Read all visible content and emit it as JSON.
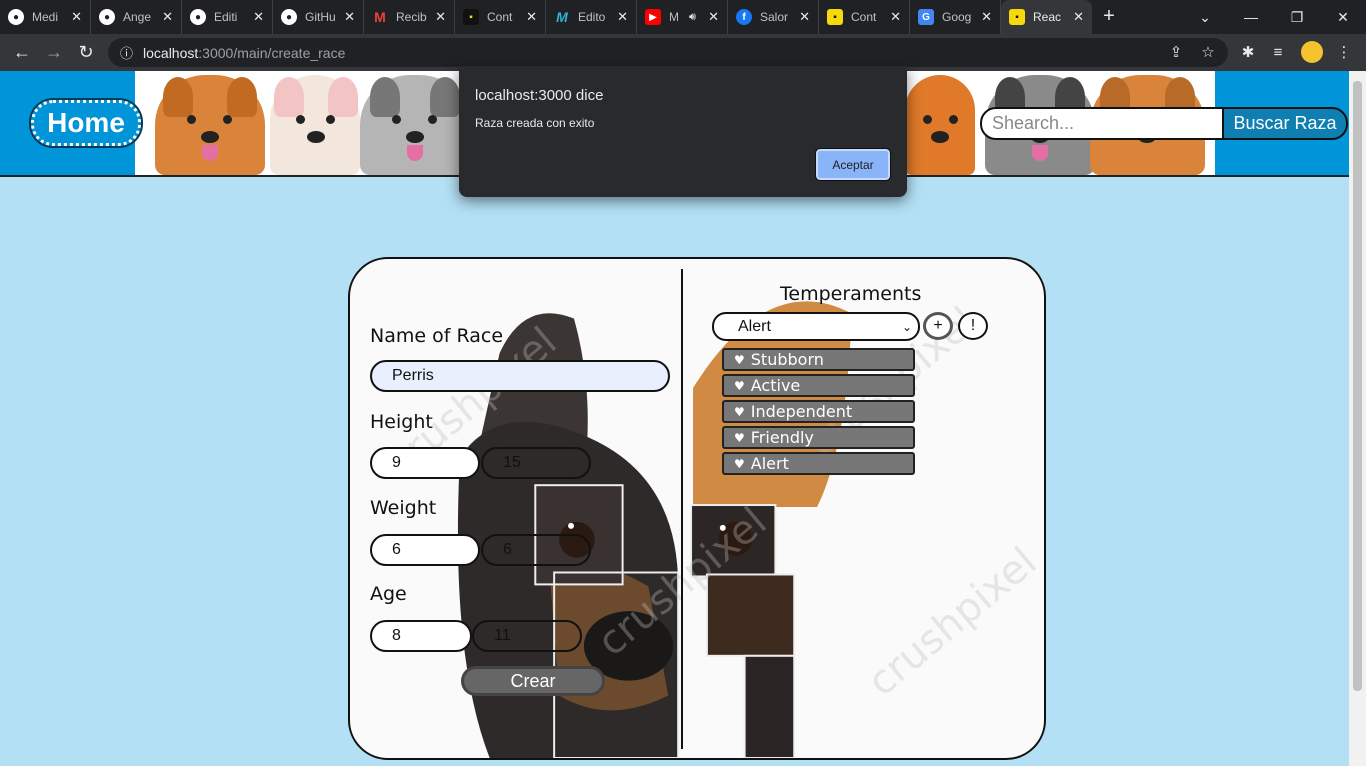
{
  "browser": {
    "tabs": [
      {
        "title": "Medi",
        "icon": "github-icon",
        "color": "#ffffff"
      },
      {
        "title": "Ange",
        "icon": "github-icon",
        "color": "#ffffff"
      },
      {
        "title": "Editi",
        "icon": "github-icon",
        "color": "#ffffff"
      },
      {
        "title": "GitHu",
        "icon": "github-icon",
        "color": "#ffffff"
      },
      {
        "title": "Recib",
        "icon": "gmail-icon",
        "color": "#ea4335"
      },
      {
        "title": "Cont",
        "icon": "app-icon",
        "color": "#f5d90a"
      },
      {
        "title": "Edito",
        "icon": "m-icon",
        "color": "#2bb5d6"
      },
      {
        "title": "M",
        "icon": "youtube-icon",
        "color": "#ff0000"
      },
      {
        "title": "Salor",
        "icon": "facebook-icon",
        "color": "#1877f2"
      },
      {
        "title": "Cont",
        "icon": "app-icon",
        "color": "#f5d90a"
      },
      {
        "title": "Goog",
        "icon": "google-translate-icon",
        "color": "#4285f4"
      },
      {
        "title": "Reac",
        "icon": "app-icon",
        "color": "#f5d90a",
        "active": true
      }
    ],
    "url_host": "localhost",
    "url_path": ":3000/main/create_race"
  },
  "header": {
    "home_label": "Home",
    "search_placeholder": "Shearch...",
    "search_button": "Buscar Raza"
  },
  "form": {
    "name_label": "Name of Race",
    "name_value": "Perris",
    "height_label": "Height",
    "height_min": "9",
    "height_max": "15",
    "weight_label": "Weight",
    "weight_min": "6",
    "weight_max": "6",
    "age_label": "Age",
    "age_min": "8",
    "age_max": "11",
    "submit_label": "Crear"
  },
  "temperaments": {
    "title": "Temperaments",
    "selected": "Alert",
    "add_label": "+",
    "info_label": "!",
    "items": [
      "Stubborn",
      "Active",
      "Independent",
      "Friendly",
      "Alert"
    ]
  },
  "dialog": {
    "title": "localhost:3000 dice",
    "message": "Raza creada con exito",
    "ok_label": "Aceptar"
  },
  "watermark": "crushpixel",
  "colors": {
    "header_bg": "#0095d9",
    "page_bg": "#b3e0f5",
    "search_button_bg": "#0f7fb2",
    "dialog_bg": "#292a2d",
    "dialog_button": "#8ab4f8"
  }
}
